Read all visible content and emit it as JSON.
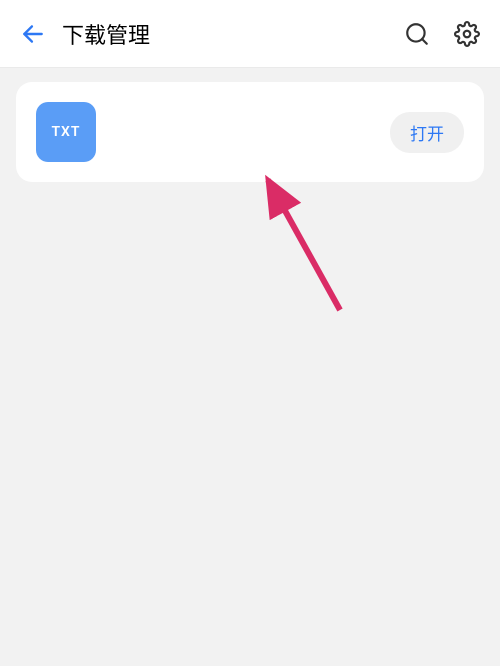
{
  "header": {
    "title": "下载管理"
  },
  "download": {
    "file_type_label": "TXT",
    "open_button_label": "打开"
  },
  "colors": {
    "accent": "#5a9df6",
    "link": "#2d78f4",
    "arrow": "#da2c66"
  }
}
